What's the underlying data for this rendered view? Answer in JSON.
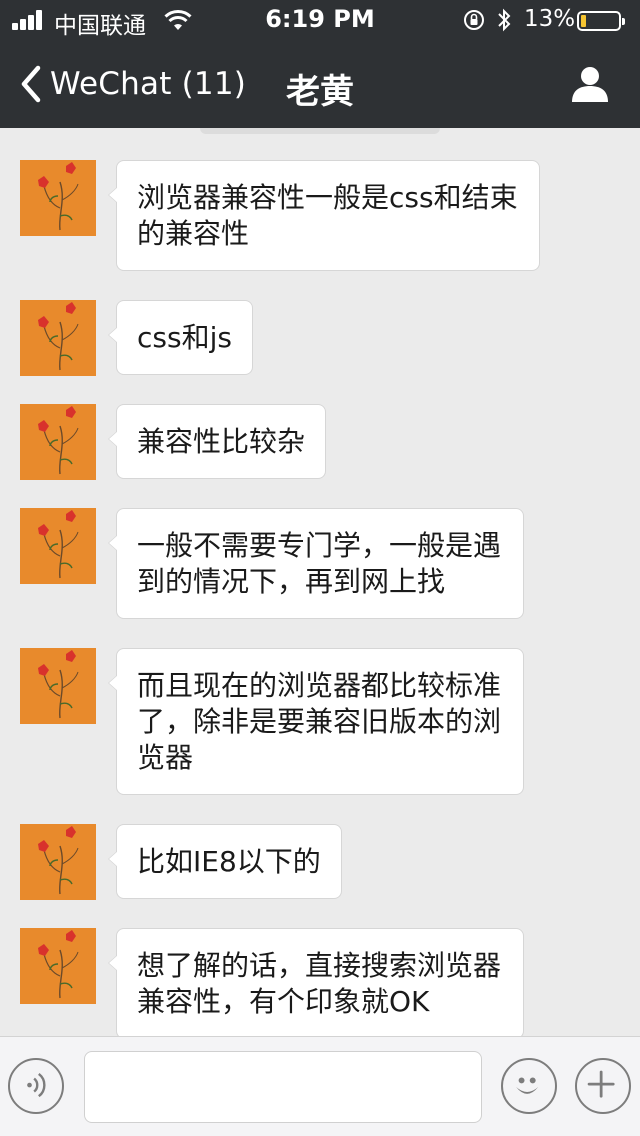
{
  "status_bar": {
    "carrier": "中国联通",
    "time": "6:19 PM",
    "battery_percent": "13%",
    "battery_level": 0.13,
    "battery_color": "#f5c431"
  },
  "nav": {
    "back_label": "WeChat (11)",
    "title": "老黄",
    "right_icon": "profile-icon"
  },
  "messages": [
    {
      "sender_avatar": "orange-flower-painting",
      "text": "浏览器兼容性一般是css和结束的兼容性"
    },
    {
      "sender_avatar": "orange-flower-painting",
      "text": "css和js"
    },
    {
      "sender_avatar": "orange-flower-painting",
      "text": "兼容性比较杂"
    },
    {
      "sender_avatar": "orange-flower-painting",
      "text": "一般不需要专门学，一般是遇到的情况下，再到网上找"
    },
    {
      "sender_avatar": "orange-flower-painting",
      "text": "而且现在的浏览器都比较标准了，除非是要兼容旧版本的浏览器"
    },
    {
      "sender_avatar": "orange-flower-painting",
      "text": "比如IE8以下的"
    },
    {
      "sender_avatar": "orange-flower-painting",
      "text": "想了解的话，直接搜索浏览器兼容性，有个印象就OK"
    }
  ],
  "input_bar": {
    "left_icon": "voice-icon",
    "text_value": "",
    "emoji_icon": "emoji-icon",
    "more_icon": "plus-icon"
  },
  "colors": {
    "nav_bg": "#2e3134",
    "chat_bg": "#ebebeb",
    "bubble_bg": "#ffffff",
    "avatar_bg": "#e88a2c"
  }
}
